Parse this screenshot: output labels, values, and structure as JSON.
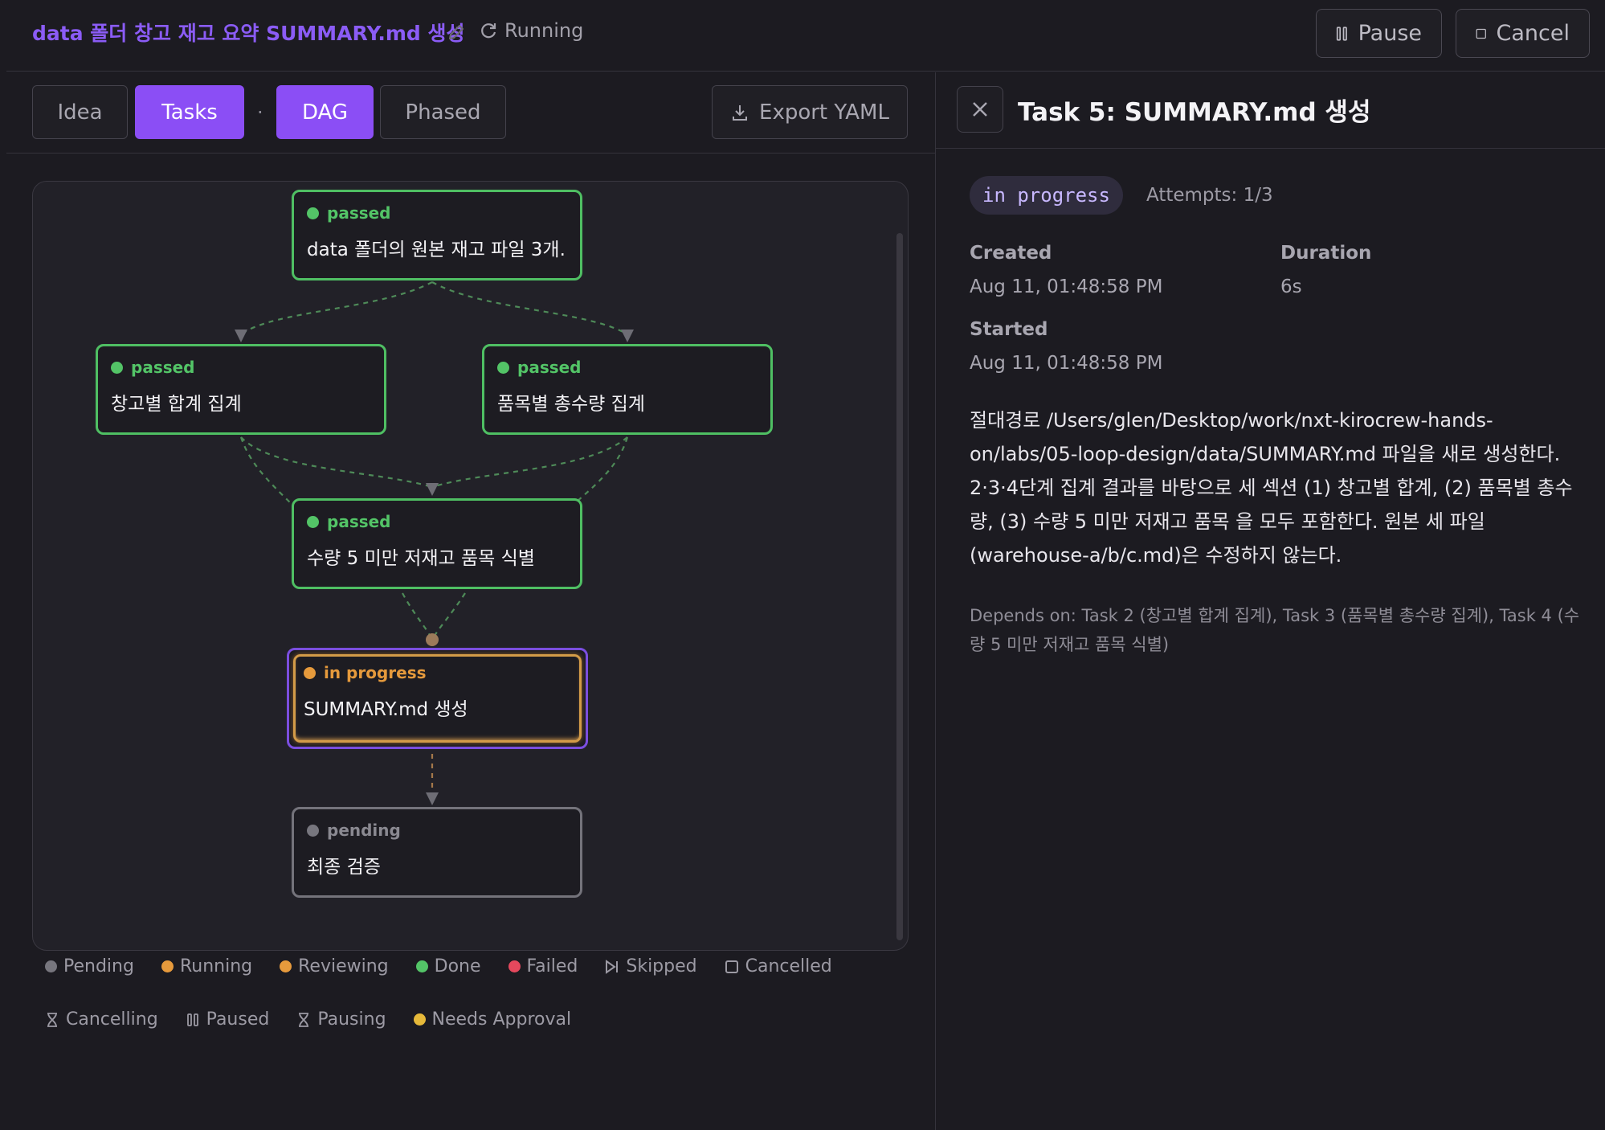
{
  "header": {
    "run_title": "data 폴더 창고 재고 요약 SUMMARY.md 생성",
    "status": "Running",
    "pause_label": "Pause",
    "cancel_label": "Cancel"
  },
  "tabs": {
    "idea": "Idea",
    "tasks": "Tasks",
    "separator": "·",
    "dag": "DAG",
    "phased": "Phased",
    "export": "Export YAML"
  },
  "dag": {
    "nodes": [
      {
        "status": "passed",
        "title": "data 폴더의 원본 재고 파일 3개..."
      },
      {
        "status": "passed",
        "title": "창고별 합계 집계"
      },
      {
        "status": "passed",
        "title": "품목별 총수량 집계"
      },
      {
        "status": "passed",
        "title": "수량 5 미만 저재고 품목 식별"
      },
      {
        "status": "in progress",
        "title": "SUMMARY.md 생성"
      },
      {
        "status": "pending",
        "title": "최종 검증"
      }
    ],
    "colors": {
      "passed": "#4fbf63",
      "in_progress": "#e69a3c",
      "selected": "#7b4ee0",
      "pending": "#74737b"
    }
  },
  "legend": {
    "pending": "Pending",
    "running": "Running",
    "reviewing": "Reviewing",
    "done": "Done",
    "failed": "Failed",
    "skipped": "Skipped",
    "cancelled": "Cancelled",
    "cancelling": "Cancelling",
    "paused": "Paused",
    "pausing": "Pausing",
    "needs_approval": "Needs Approval"
  },
  "detail": {
    "title": "Task 5: SUMMARY.md 생성",
    "badge": "in progress",
    "attempts": "Attempts: 1/3",
    "created_label": "Created",
    "created_value": "Aug 11, 01:48:58 PM",
    "duration_label": "Duration",
    "duration_value": "6s",
    "started_label": "Started",
    "started_value": "Aug 11, 01:48:58 PM",
    "description": "절대경로 /Users/glen/Desktop/work/nxt-kirocrew-hands-on/labs/05-loop-design/data/SUMMARY.md 파일을 새로 생성한다. 2·3·4단계 집계 결과를 바탕으로 세 섹션 (1) 창고별 합계, (2) 품목별 총수량, (3) 수량 5 미만 저재고 품목 을 모두 포함한다. 원본 세 파일 (warehouse-a/b/c.md)은 수정하지 않는다.",
    "depends": "Depends on: Task 2 (창고별 합계 집계), Task 3 (품목별 총수량 집계), Task 4 (수량 5 미만 저재고 품목 식별)"
  }
}
